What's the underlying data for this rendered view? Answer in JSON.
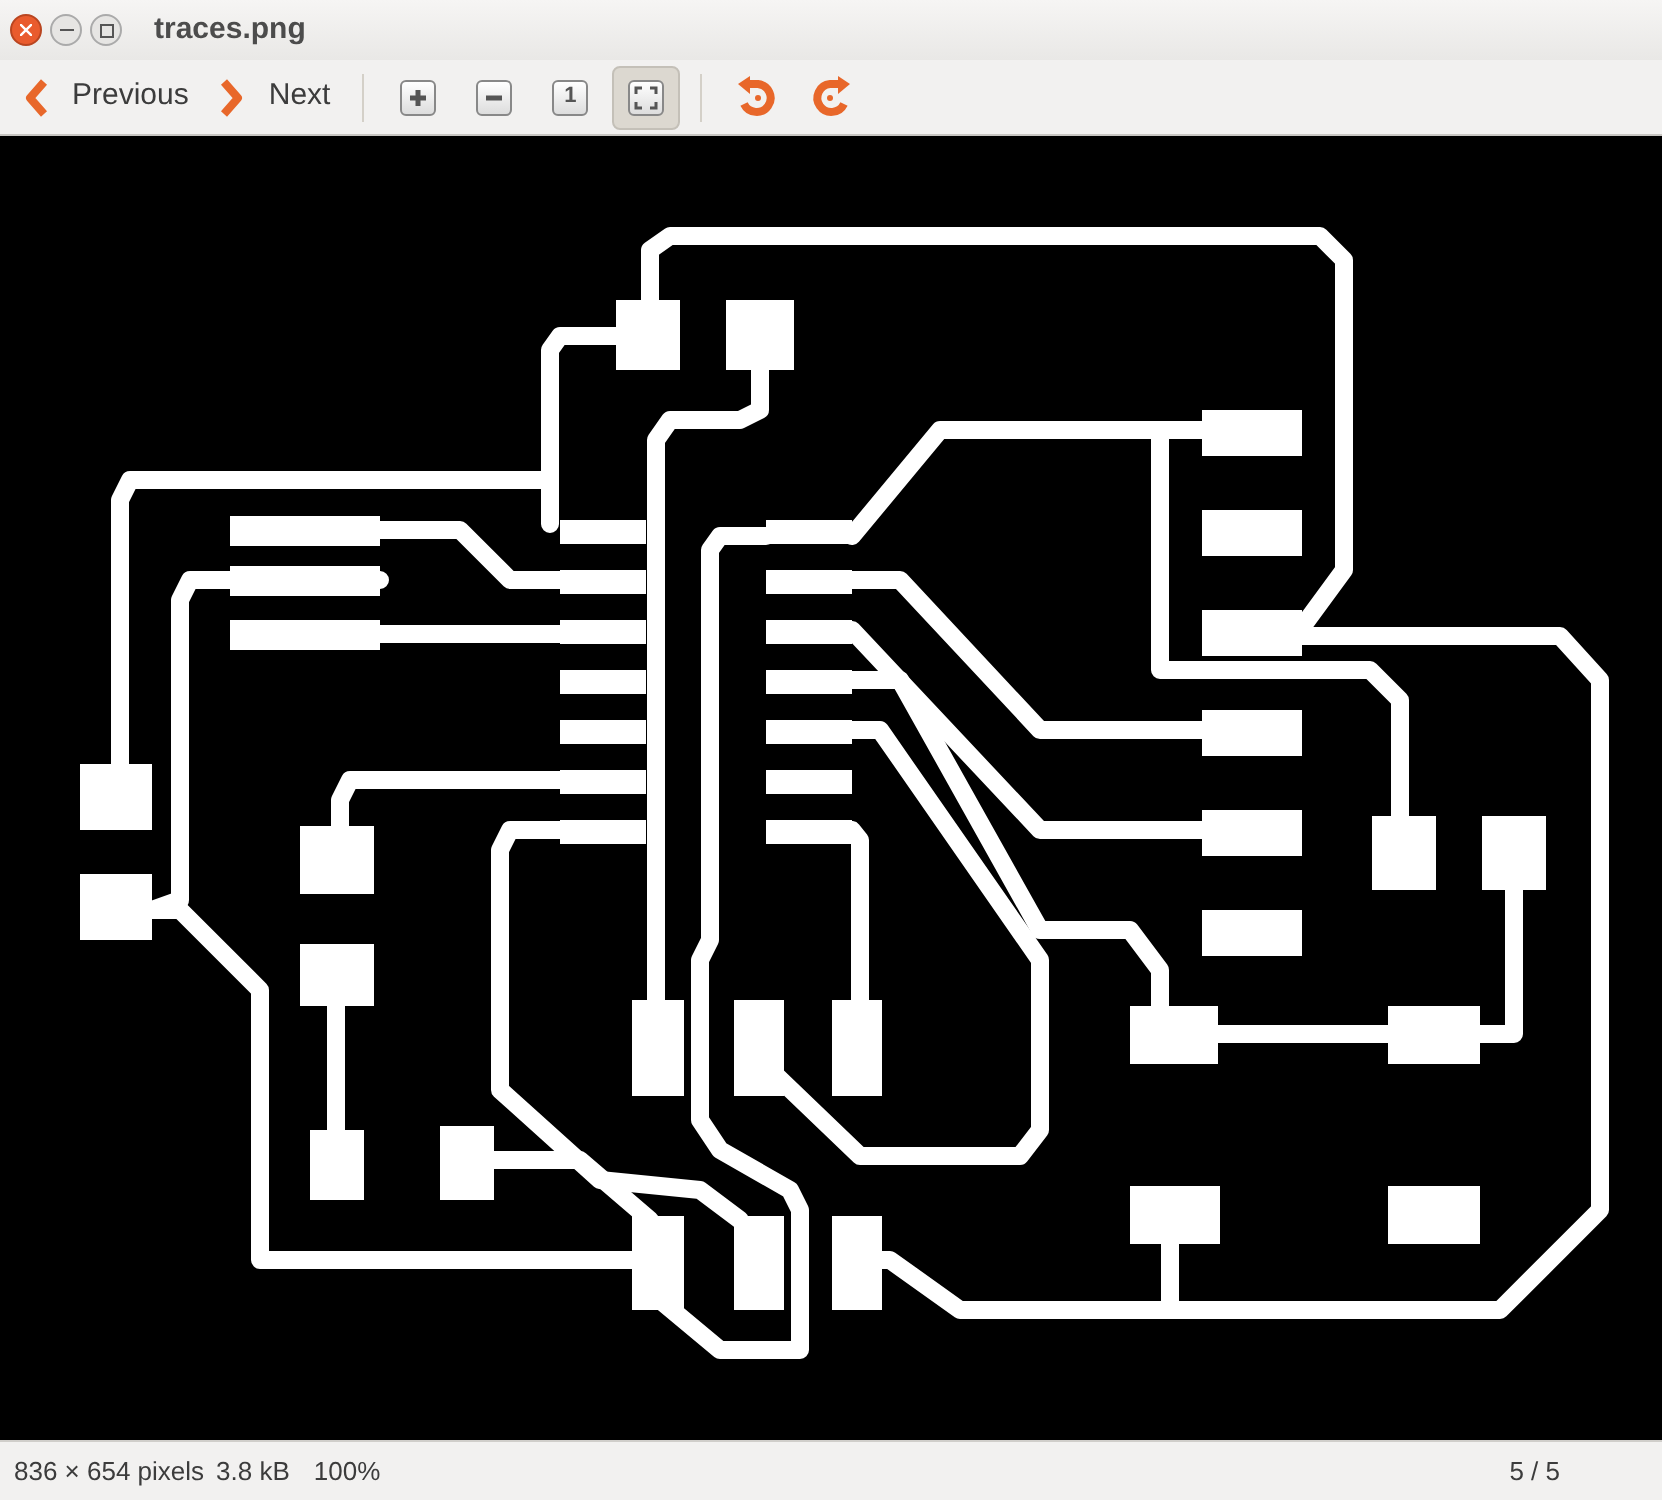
{
  "window": {
    "title": "traces.png"
  },
  "toolbar": {
    "items": [
      {
        "kind": "prev",
        "label": "Previous",
        "selected": false
      },
      {
        "kind": "next",
        "label": "Next",
        "selected": false
      },
      {
        "kind": "separator"
      },
      {
        "kind": "zoom-in",
        "selected": false
      },
      {
        "kind": "zoom-out",
        "selected": false
      },
      {
        "kind": "normal",
        "label": "1",
        "selected": false
      },
      {
        "kind": "fit",
        "selected": true
      },
      {
        "kind": "separator"
      },
      {
        "kind": "rotate-left",
        "selected": false
      },
      {
        "kind": "rotate-right",
        "selected": false
      }
    ]
  },
  "status_bar": {
    "dimensions": "836 × 654 pixels",
    "size": "3.8 kB",
    "zoom": "100%",
    "position": "5 / 5"
  }
}
